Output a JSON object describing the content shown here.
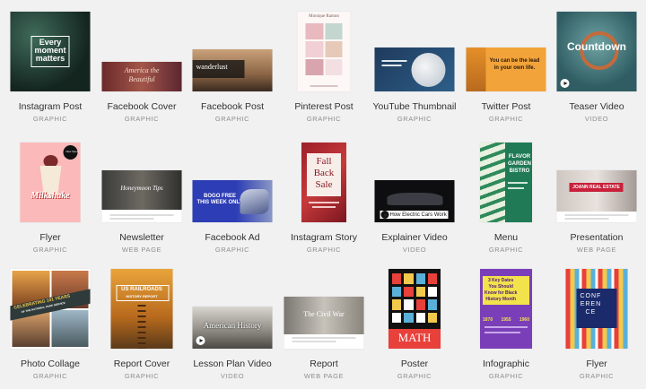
{
  "templates": [
    {
      "label": "Instagram Post",
      "type": "GRAPHIC",
      "thumb_text": [
        "Every",
        "moment",
        "matters"
      ]
    },
    {
      "label": "Facebook Cover",
      "type": "GRAPHIC",
      "thumb_text": [
        "America the",
        "Beautiful"
      ]
    },
    {
      "label": "Facebook Post",
      "type": "GRAPHIC",
      "thumb_text": [
        "wanderlust"
      ]
    },
    {
      "label": "Pinterest Post",
      "type": "GRAPHIC",
      "thumb_text": [
        "Monique Ramon"
      ]
    },
    {
      "label": "YouTube Thumbnail",
      "type": "GRAPHIC",
      "thumb_text": []
    },
    {
      "label": "Twitter Post",
      "type": "GRAPHIC",
      "thumb_text": [
        "You can be the lead",
        "in your own life."
      ]
    },
    {
      "label": "Teaser Video",
      "type": "VIDEO",
      "thumb_text": [
        "Countdown"
      ]
    },
    {
      "label": "Flyer",
      "type": "GRAPHIC",
      "thumb_text": [
        "Milkshake",
        "Now Open"
      ]
    },
    {
      "label": "Newsletter",
      "type": "WEB PAGE",
      "thumb_text": [
        "Honeymoon Tips"
      ]
    },
    {
      "label": "Facebook Ad",
      "type": "GRAPHIC",
      "thumb_text": [
        "BOGO FREE",
        "THIS WEEK ONLY"
      ]
    },
    {
      "label": "Instagram Story",
      "type": "GRAPHIC",
      "thumb_text": [
        "Fall",
        "Back",
        "Sale"
      ]
    },
    {
      "label": "Explainer Video",
      "type": "VIDEO",
      "thumb_text": [
        "How Electric Cars Work"
      ]
    },
    {
      "label": "Menu",
      "type": "GRAPHIC",
      "thumb_text": [
        "FLAVOR",
        "GARDEN",
        "BISTRO"
      ]
    },
    {
      "label": "Presentation",
      "type": "WEB PAGE",
      "thumb_text": [
        "JOANN REAL ESTATE"
      ]
    },
    {
      "label": "Photo Collage",
      "type": "GRAPHIC",
      "thumb_text": [
        "CELEBRATING 101 YEARS",
        "OF THE NATIONAL PARK SERVICE"
      ]
    },
    {
      "label": "Report Cover",
      "type": "GRAPHIC",
      "thumb_text": [
        "US RAILROADS",
        "HISTORY REPORT"
      ]
    },
    {
      "label": "Lesson Plan Video",
      "type": "VIDEO",
      "thumb_text": [
        "American History"
      ]
    },
    {
      "label": "Report",
      "type": "WEB PAGE",
      "thumb_text": [
        "The Civil War"
      ]
    },
    {
      "label": "Poster",
      "type": "GRAPHIC",
      "thumb_text": [
        "MATH"
      ]
    },
    {
      "label": "Infographic",
      "type": "GRAPHIC",
      "thumb_text": [
        "3 Key Dates",
        "You Should",
        "Know for Black",
        "History Month",
        "1870",
        "1955",
        "1960"
      ]
    },
    {
      "label": "Flyer",
      "type": "GRAPHIC",
      "thumb_text": [
        "CONF",
        "EREN",
        "CE"
      ]
    }
  ]
}
